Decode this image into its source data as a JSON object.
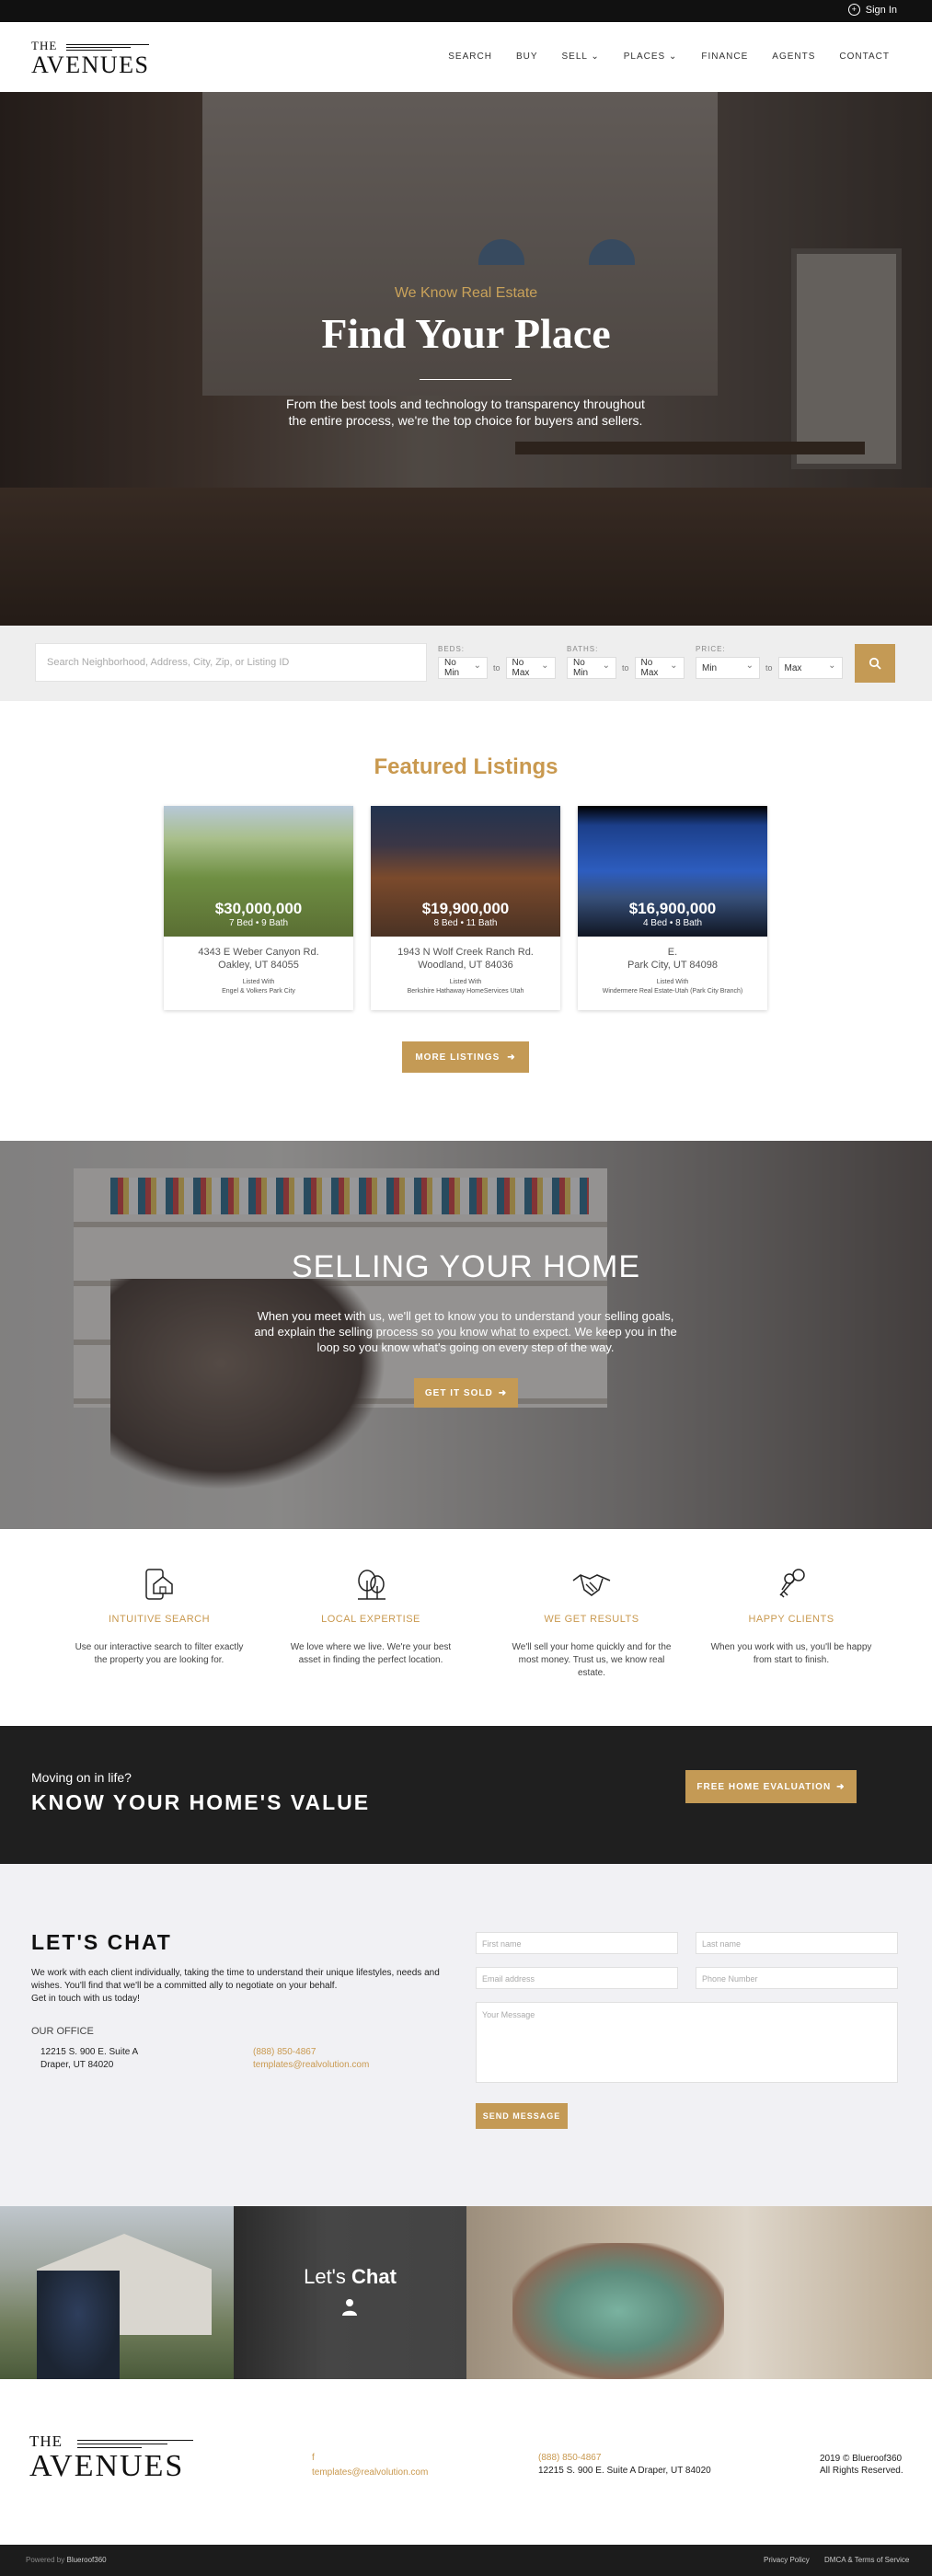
{
  "topbar": {
    "signin": "Sign In"
  },
  "logo": {
    "the": "THE",
    "name": "AVENUES"
  },
  "nav": [
    "SEARCH",
    "BUY",
    "SELL ⌄",
    "PLACES ⌄",
    "FINANCE",
    "AGENTS",
    "CONTACT"
  ],
  "hero": {
    "tagline": "We Know Real Estate",
    "title": "Find Your Place",
    "text": "From the best tools and technology to transparency throughout the entire process, we're the top choice for buyers and sellers."
  },
  "search": {
    "placeholder": "Search Neighborhood, Address, City, Zip, or Listing ID",
    "beds_label": "BEDS:",
    "baths_label": "BATHS:",
    "price_label": "PRICE:",
    "beds_min": "No Min",
    "beds_max": "No Max",
    "baths_min": "No Min",
    "baths_max": "No Max",
    "price_min": "Min",
    "price_max": "Max",
    "to": "to",
    "search_icon": "search-icon"
  },
  "featured": {
    "title": "Featured Listings",
    "more": "MORE LISTINGS",
    "listings": [
      {
        "price": "$30,000,000",
        "beds": "7 Bed • 9 Bath",
        "addr1": "4343 E Weber Canyon Rd.",
        "addr2": "Oakley, UT 84055",
        "listed": "Listed With",
        "office": "Engel & Volkers Park City"
      },
      {
        "price": "$19,900,000",
        "beds": "8 Bed • 11 Bath",
        "addr1": "1943 N Wolf Creek Ranch Rd.",
        "addr2": "Woodland, UT 84036",
        "listed": "Listed With",
        "office": "Berkshire Hathaway HomeServices Utah"
      },
      {
        "price": "$16,900,000",
        "beds": "4 Bed • 8 Bath",
        "addr1": "E.",
        "addr2": "Park City, UT 84098",
        "listed": "Listed With",
        "office": "Windermere Real Estate-Utah (Park City Branch)"
      }
    ]
  },
  "sell": {
    "title": "SELLING YOUR HOME",
    "text": "When you meet with us, we'll get to know you to understand your selling goals, and explain the selling process so you know what to expect. We keep you in the loop so you know what's going on every step of the way.",
    "button": "GET IT SOLD"
  },
  "features": [
    {
      "icon": "phone-home-icon",
      "title": "INTUITIVE SEARCH",
      "desc": "Use our interactive search to filter exactly the property you are looking for."
    },
    {
      "icon": "tree-icon",
      "title": "LOCAL EXPERTISE",
      "desc": "We love where we live. We're your best asset in finding the perfect location."
    },
    {
      "icon": "handshake-icon",
      "title": "WE GET RESULTS",
      "desc": "We'll sell your home quickly and for the most money. Trust us, we know real estate."
    },
    {
      "icon": "keys-icon",
      "title": "HAPPY CLIENTS",
      "desc": "When you work with us, you'll be happy from start to finish."
    }
  ],
  "value": {
    "small": "Moving on in life?",
    "title": "KNOW YOUR HOME'S VALUE",
    "button": "FREE HOME EVALUATION"
  },
  "chat": {
    "title": "LET'S CHAT",
    "desc": "We work with each client individually, taking the time to understand their unique lifestyles, needs and wishes. You'll find that we'll be a committed ally to negotiate on your behalf.",
    "desc2": "Get in touch with us today!",
    "office_label": "OUR OFFICE",
    "addr1": "12215 S. 900 E. Suite A",
    "addr2": "Draper, UT 84020",
    "phone": "(888) 850-4867",
    "email": "templates@realvolution.com",
    "first": "First name",
    "last": "Last name",
    "emailph": "Email address",
    "phoneph": "Phone Number",
    "message": "Your Message",
    "send": "SEND MESSAGE"
  },
  "photos": {
    "lets": "Let's",
    "chat": "Chat"
  },
  "footer": {
    "the": "THE",
    "name": "AVENUES",
    "social": "f",
    "email": "templates@realvolution.com",
    "phone": "(888) 850-4867",
    "address": "12215 S. 900 E. Suite A Draper, UT 84020",
    "copy1": "2019 © Blueroof360",
    "copy2": "All Rights Reserved.",
    "powered": "Powered by",
    "powered_by": "Blueroof360",
    "privacy": "Privacy Policy",
    "dmca": "DMCA & Terms of Service"
  },
  "colors": {
    "accent": "#c49a55",
    "dark": "#1f1f1f",
    "light_bg": "#f1f1f4"
  }
}
